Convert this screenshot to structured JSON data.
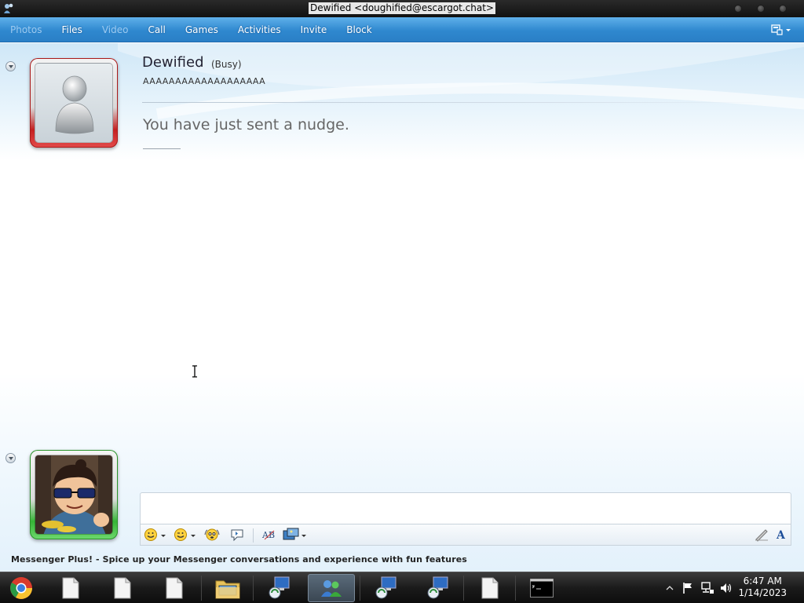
{
  "window": {
    "title": "Dewified <doughified@escargot.chat>"
  },
  "menu": {
    "items": [
      {
        "label": "Photos",
        "enabled": false
      },
      {
        "label": "Files",
        "enabled": true
      },
      {
        "label": "Video",
        "enabled": false
      },
      {
        "label": "Call",
        "enabled": true
      },
      {
        "label": "Games",
        "enabled": true
      },
      {
        "label": "Activities",
        "enabled": true
      },
      {
        "label": "Invite",
        "enabled": true
      },
      {
        "label": "Block",
        "enabled": true
      }
    ]
  },
  "contact": {
    "name": "Dewified",
    "status": "(Busy)",
    "personal_message": "AAAAAAAAAAAAAAAAAAA",
    "frame_color": "#d42a2a"
  },
  "conversation": {
    "messages": [
      "You have just sent a nudge."
    ]
  },
  "self": {
    "frame_color": "#3cc23c"
  },
  "toolbar": {
    "icons": [
      "emoticon-icon",
      "wink-icon",
      "nudge-icon",
      "voice-clip-icon",
      "spellcheck-icon",
      "background-icon",
      "handwriting-icon",
      "font-icon"
    ]
  },
  "banner": {
    "text": "Messenger Plus! - Spice up your Messenger conversations and experience with fun features"
  },
  "taskbar": {
    "time": "6:47 AM",
    "date": "1/14/2023"
  }
}
